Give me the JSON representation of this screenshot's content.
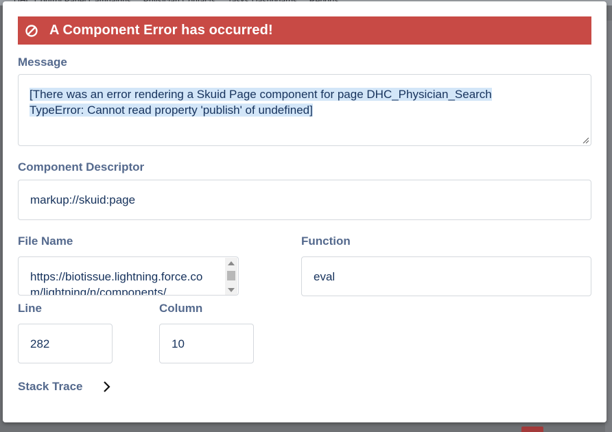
{
  "background": {
    "nav_text": "DHC Control Panel      Campaigns   ⌄      Physician Contacts   ⌄      Tasks      Dashboards   ⌄      Reports"
  },
  "modal": {
    "title": "A Component Error has occurred!",
    "title_icon": "prohibited-icon",
    "header_color": "#c84a45",
    "message": {
      "label": "Message",
      "line1": "[There was an error rendering a Skuid Page component for page DHC_Physician_Search",
      "line2": "TypeError: Cannot read property 'publish' of undefined]"
    },
    "component_descriptor": {
      "label": "Component Descriptor",
      "value": "markup://skuid:page"
    },
    "file_name": {
      "label": "File Name",
      "value": "https://biotissue.lightning.force.com/lightning/n/components/"
    },
    "function": {
      "label": "Function",
      "value": "eval"
    },
    "line": {
      "label": "Line",
      "value": "282"
    },
    "column": {
      "label": "Column",
      "value": "10"
    },
    "stack_trace": {
      "label": "Stack Trace",
      "icon": "chevron-right-icon"
    }
  }
}
